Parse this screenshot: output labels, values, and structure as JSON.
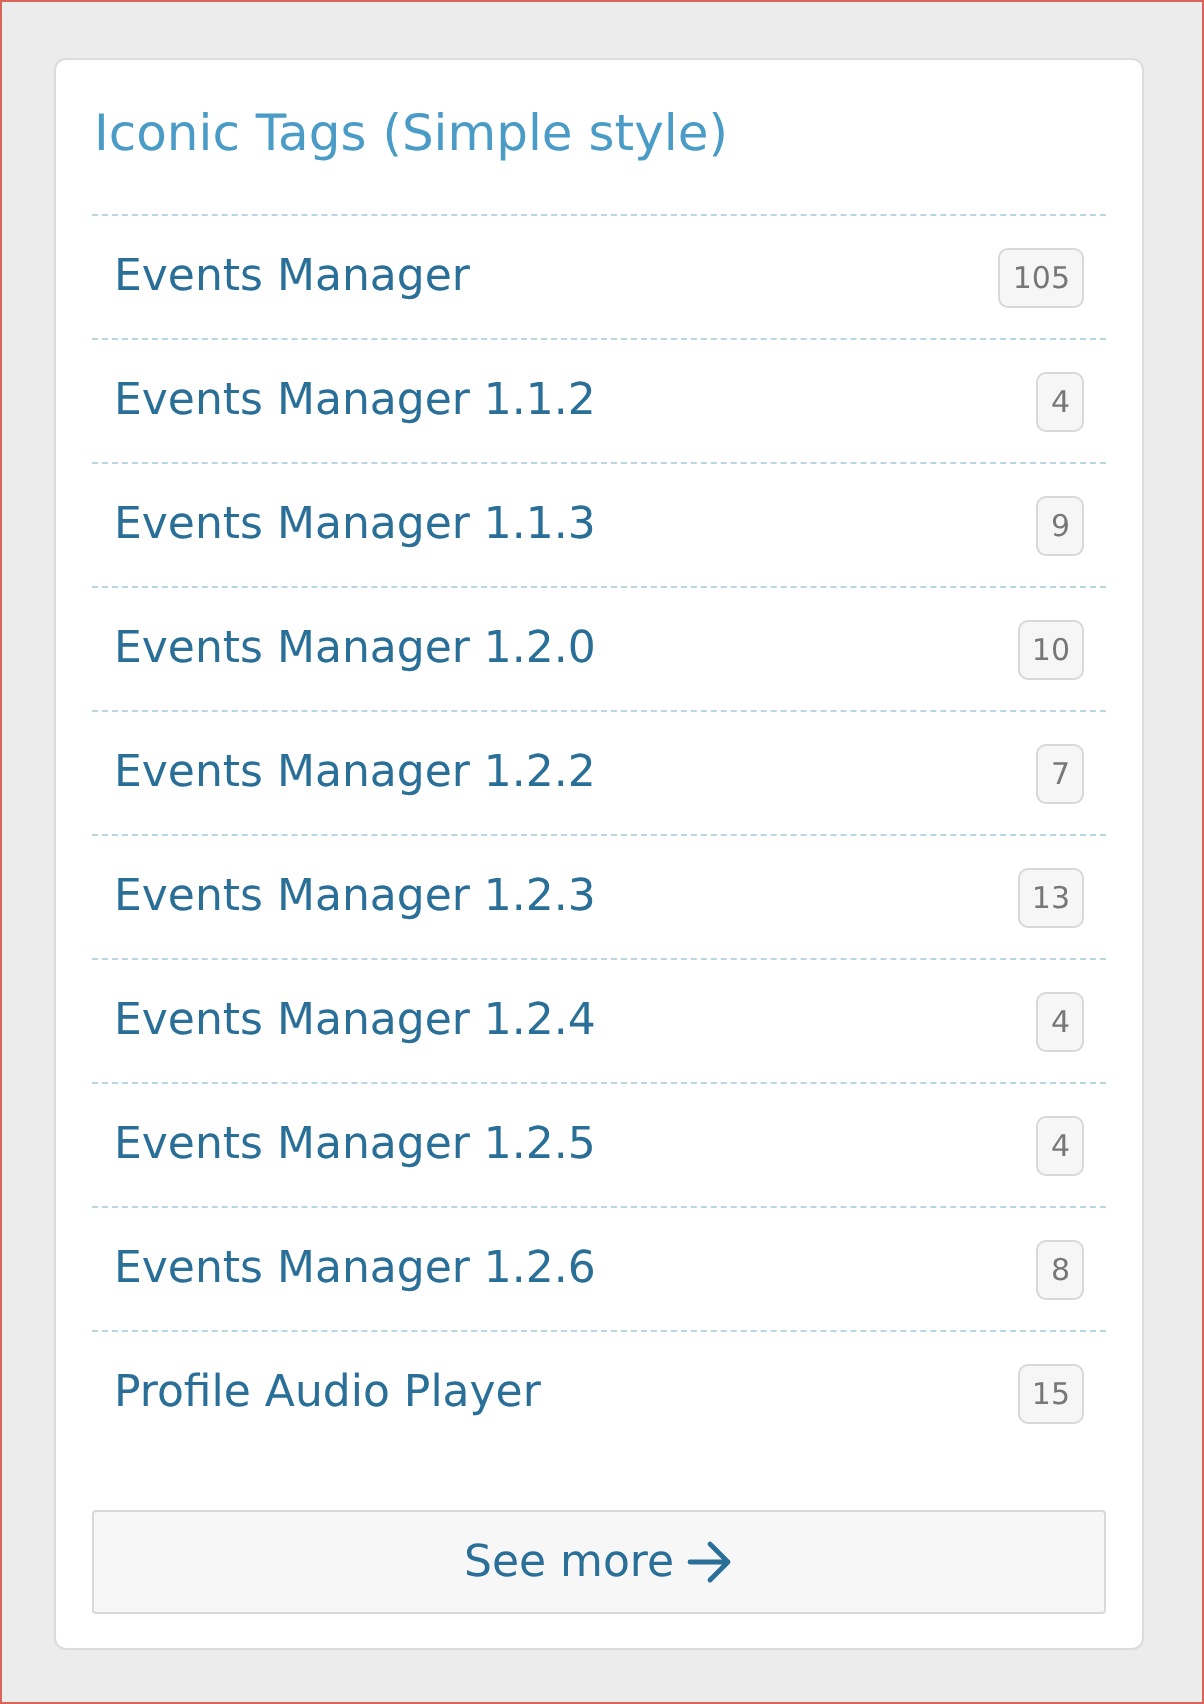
{
  "widget": {
    "title": "Iconic Tags (Simple style)",
    "tags": [
      {
        "label": "Events Manager",
        "count": "105"
      },
      {
        "label": "Events Manager 1.1.2",
        "count": "4"
      },
      {
        "label": "Events Manager 1.1.3",
        "count": "9"
      },
      {
        "label": "Events Manager 1.2.0",
        "count": "10"
      },
      {
        "label": "Events Manager 1.2.2",
        "count": "7"
      },
      {
        "label": "Events Manager 1.2.3",
        "count": "13"
      },
      {
        "label": "Events Manager 1.2.4",
        "count": "4"
      },
      {
        "label": "Events Manager 1.2.5",
        "count": "4"
      },
      {
        "label": "Events Manager 1.2.6",
        "count": "8"
      },
      {
        "label": "Profile Audio Player",
        "count": "15"
      }
    ],
    "see_more": {
      "label": "See more"
    }
  }
}
